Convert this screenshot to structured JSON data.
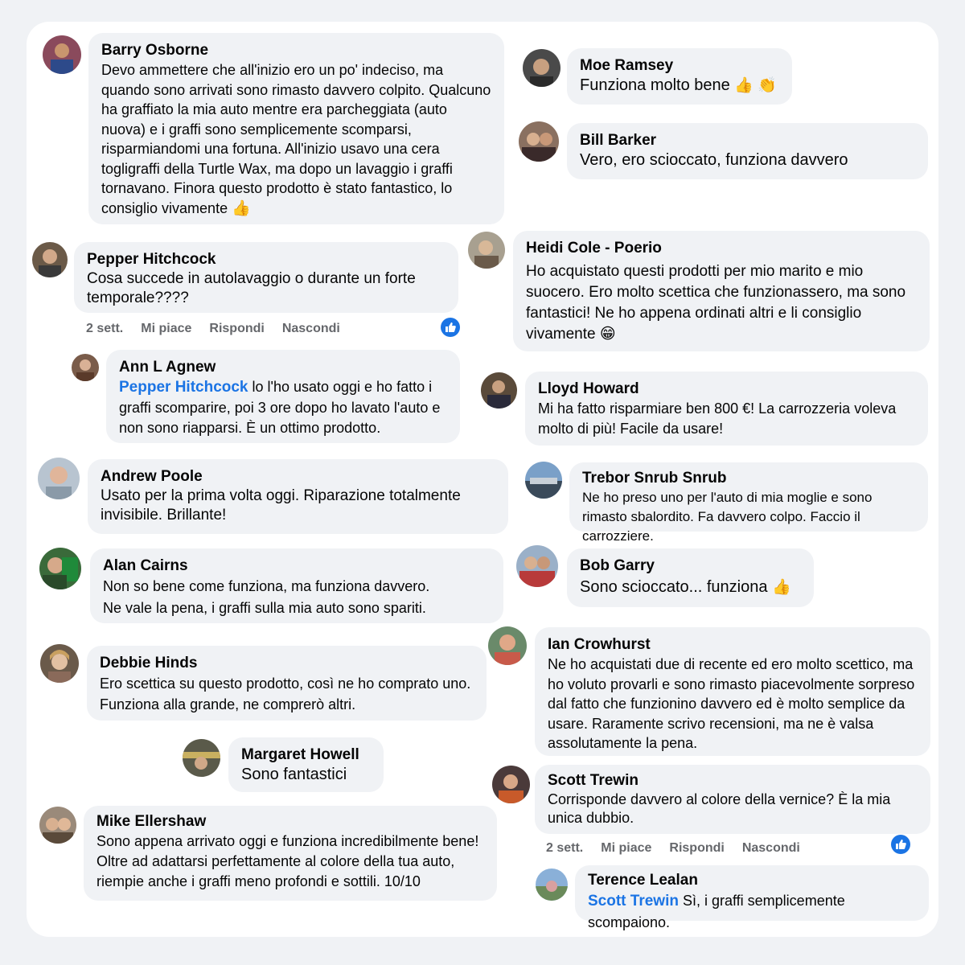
{
  "colors": {
    "bubble": "#f0f2f5",
    "mention": "#1b74e4",
    "action": "#65676b",
    "like": "#1b74e4"
  },
  "comments": {
    "barry": {
      "name": "Barry Osborne",
      "text": "Devo ammettere che all'inizio ero un po' indeciso, ma quando sono arrivati sono rimasto davvero colpito. Qualcuno ha graffiato la mia auto mentre era parcheggiata (auto nuova) e i graffi sono semplicemente scomparsi, risparmiandomi una fortuna. All'inizio usavo una cera togligraffi della Turtle Wax, ma dopo un lavaggio i graffi tornavano. Finora questo prodotto è stato fantastico, lo consiglio vivamente",
      "emoji": "👍"
    },
    "pepper": {
      "name": "Pepper Hitchcock",
      "text": "Cosa succede in autolavaggio o durante un  forte temporale????",
      "time": "2 sett.",
      "like": "Mi piace",
      "reply": "Rispondi",
      "hide": "Nascondi"
    },
    "ann": {
      "name": "Ann L Agnew",
      "mention": "Pepper Hitchcock",
      "text": " lo l'ho usato oggi e ho fatto i graffi scomparire, poi 3 ore dopo ho lavato l'auto e non sono riapparsi. È un ottimo prodotto."
    },
    "andrew": {
      "name": "Andrew Poole",
      "text": "Usato per la prima volta oggi. Riparazione totalmente invisibile. Brillante!"
    },
    "alan": {
      "name": "Alan Cairns",
      "text1": "Non so bene come funziona, ma funziona davvero.",
      "text2": "Ne vale la pena, i graffi sulla mia auto sono spariti."
    },
    "debbie": {
      "name": "Debbie Hinds",
      "text1": "Ero scettica su questo prodotto, così ne ho comprato uno.",
      "text2": "Funziona alla grande, ne comprerò altri."
    },
    "margaret": {
      "name": "Margaret Howell",
      "text": "Sono fantastici"
    },
    "mike": {
      "name": "Mike Ellershaw",
      "text1": "Sono appena arrivato oggi e funziona incredibilmente bene!",
      "text2": "Oltre ad adattarsi perfettamente al colore della tua auto, riempie anche i graffi meno profondi e sottili. 10/10"
    },
    "moe": {
      "name": "Moe Ramsey",
      "text": "Funziona molto bene",
      "emoji": "👍 👏"
    },
    "bill": {
      "name": "Bill Barker",
      "text": "Vero, ero scioccato, funziona davvero"
    },
    "heidi": {
      "name": "Heidi Cole - Poerio",
      "text": "Ho acquistato questi prodotti per mio marito e mio suocero. Ero molto scettica che funzionassero, ma sono fantastici! Ne ho appena ordinati altri e li consiglio vivamente",
      "emoji": "😁"
    },
    "lloyd": {
      "name": "Lloyd Howard",
      "text": "Mi ha fatto risparmiare ben 800 €! La carrozzeria voleva molto di più! Facile da usare!"
    },
    "trebor": {
      "name": "Trebor Snrub Snrub",
      "text": "Ne ho preso uno per l'auto di mia moglie e sono rimasto sbalordito. Fa davvero colpo. Faccio il carrozziere."
    },
    "bob": {
      "name": "Bob Garry",
      "text": "Sono scioccato... funziona",
      "emoji": "👍"
    },
    "ian": {
      "name": "Ian Crowhurst",
      "text1": "Ne ho acquistati due di recente ed ero molto scettico,",
      "text2": "ma ho voluto provarli e sono rimasto piacevolmente sorpreso dal fatto che funzionino davvero ed è molto semplice da usare.",
      "text3": "Raramente scrivo recensioni, ma ne è valsa assolutamente la pena."
    },
    "scott": {
      "name": "Scott Trewin",
      "text": "Corrisponde davvero al colore della vernice? È la mia unica dubbio.",
      "time": "2 sett.",
      "like": "Mi piace",
      "reply": "Rispondi",
      "hide": "Nascondi"
    },
    "terence": {
      "name": "Terence Lealan",
      "mention": "Scott Trewin",
      "text": " Sì, i graffi semplicemente scompaiono."
    }
  }
}
